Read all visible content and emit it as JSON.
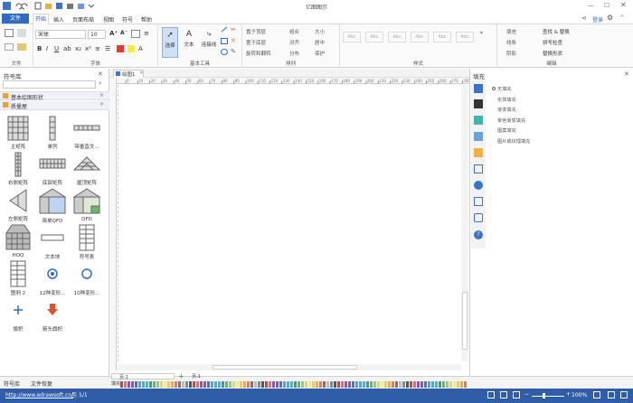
{
  "window": {
    "title": "亿图图示"
  },
  "ribbon_tabs": [
    "文件",
    "开始",
    "插入",
    "页面布局",
    "视图",
    "符号",
    "帮助"
  ],
  "ribbon_right": {
    "login": "登录"
  },
  "font": {
    "family": "宋体",
    "size": "10"
  },
  "groups": {
    "file": "文件",
    "font": "字体",
    "basic_tools": "基本工具",
    "arrange": "排列",
    "style": "样式",
    "edit": "编辑"
  },
  "tools": {
    "select": "选择",
    "text": "文本",
    "connector": "连接线"
  },
  "arrange_items": [
    "置于顶层",
    "置于底层",
    "旋转和翻转",
    "组合",
    "对齐",
    "分布",
    "大小",
    "居中",
    "保护"
  ],
  "style_thumbs": [
    "Abc",
    "Abc",
    "Abc",
    "Abc",
    "Abc",
    "Abc"
  ],
  "edit_items": {
    "fill": "填充",
    "line": "线条",
    "shadow": "阴影",
    "find_replace": "查找 & 替换",
    "spell_check": "拼写检查",
    "replace_shape": "替换形状"
  },
  "library": {
    "title": "符号库",
    "categories": [
      "基本绘图形状",
      "质量屋"
    ],
    "shapes": [
      {
        "label": "主矩阵"
      },
      {
        "label": "单列"
      },
      {
        "label": "带垂直文..."
      },
      {
        "label": "右侧矩阵"
      },
      {
        "label": "底部矩阵"
      },
      {
        "label": "屋顶矩阵"
      },
      {
        "label": "左侧矩阵"
      },
      {
        "label": "简单QFD"
      },
      {
        "label": "QFD"
      },
      {
        "label": "HOQ"
      },
      {
        "label": "文本块"
      },
      {
        "label": "符号表"
      },
      {
        "label": "图例 2"
      },
      {
        "label": "12种变形..."
      },
      {
        "label": "10种变形..."
      },
      {
        "label": "旗帜"
      },
      {
        "label": "箭头旗帜"
      }
    ]
  },
  "document_tab": {
    "name": "绘图1"
  },
  "ruler_ticks": [
    "0",
    "10",
    "20",
    "30",
    "40",
    "50",
    "60",
    "70",
    "80",
    "90",
    "100",
    "110",
    "120",
    "130",
    "140",
    "150",
    "160",
    "170",
    "180",
    "190",
    "200",
    "210",
    "220",
    "230",
    "240",
    "250",
    "260",
    "270",
    "280",
    "290"
  ],
  "page_tabs": {
    "current": "页-1",
    "tab": "页-1"
  },
  "fill_panel": {
    "title": "填充",
    "options": [
      "无填充",
      "实体填充",
      "渐变填充",
      "单色渐变填充",
      "图案填充",
      "图片或纹理填充"
    ]
  },
  "bottom_tabs": [
    "符号库",
    "文件恢复"
  ],
  "palette_label": "填充",
  "status": {
    "url": "http://www.edrawsoft.cn/",
    "pages": "1/1",
    "zoom": "100%"
  },
  "colors": {
    "accent": "#2f5da8",
    "file_tab": "#2f6cc0"
  }
}
